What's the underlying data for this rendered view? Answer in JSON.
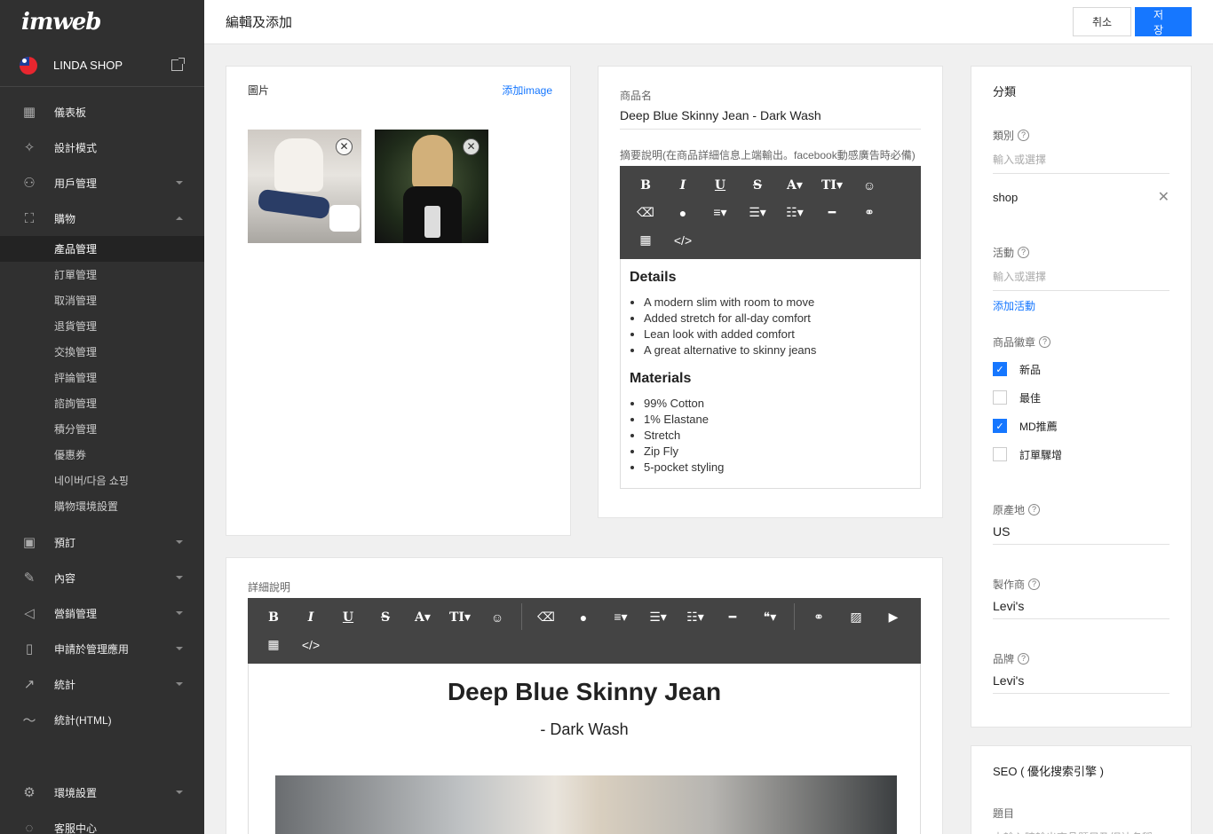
{
  "app": {
    "logo": "imweb",
    "shop_name": "LINDA SHOP"
  },
  "sidebar": {
    "items": [
      {
        "icon": "dashboard-icon",
        "label": "儀表板"
      },
      {
        "icon": "magic-wand-icon",
        "label": "設計模式"
      },
      {
        "icon": "user-icon",
        "label": "用戶管理"
      },
      {
        "icon": "shopping-bag-icon",
        "label": "購物"
      }
    ],
    "shopping_sub": [
      "產品管理",
      "訂單管理",
      "取消管理",
      "退貨管理",
      "交換管理",
      "評論管理",
      "諮詢管理",
      "積分管理",
      "優惠券",
      "네이버/다음 쇼핑",
      "購物環境設置"
    ],
    "items2": [
      {
        "icon": "calendar-icon",
        "label": "預訂"
      },
      {
        "icon": "edit-icon",
        "label": "內容"
      },
      {
        "icon": "megaphone-icon",
        "label": "營銷管理"
      },
      {
        "icon": "mobile-icon",
        "label": "申請於管理應用"
      },
      {
        "icon": "chart-icon",
        "label": "統計"
      },
      {
        "icon": "trend-icon",
        "label": "統計(HTML)"
      }
    ],
    "settings": "環境設置",
    "support": "客服中心"
  },
  "header": {
    "title": "編輯及添加",
    "cancel": "취소",
    "save": "저장"
  },
  "images": {
    "label": "圖片",
    "add": "添加image"
  },
  "product": {
    "name_label": "商品名",
    "name_value": "Deep Blue Skinny Jean - Dark Wash",
    "summary_label": "摘要說明(在商品詳細信息上端輸出。facebook動感廣告時必備)",
    "summary": {
      "h1": "Details",
      "list1": [
        "A modern slim with room to move",
        "Added stretch for all-day comfort",
        "Lean look with added comfort",
        "A great alternative to skinny jeans"
      ],
      "h2": "Materials",
      "list2": [
        "99% Cotton",
        "1% Elastane",
        "Stretch",
        "Zip Fly",
        "5-pocket styling"
      ]
    }
  },
  "detail": {
    "label": "詳細說明",
    "title": "Deep Blue Skinny Jean",
    "subtitle": "- Dark Wash"
  },
  "category": {
    "title": "分類",
    "class_label": "類別",
    "class_placeholder": "輸入或選擇",
    "tag": "shop",
    "event_label": "活動",
    "event_placeholder": "輸入或選擇",
    "add_event": "添加活動",
    "badge_label": "商品徽章",
    "badges": [
      {
        "label": "新品",
        "checked": true
      },
      {
        "label": "最佳",
        "checked": false
      },
      {
        "label": "MD推薦",
        "checked": true
      },
      {
        "label": "訂單驟增",
        "checked": false
      }
    ],
    "origin_label": "原產地",
    "origin": "US",
    "maker_label": "製作商",
    "maker": "Levi's",
    "brand_label": "品牌",
    "brand": "Levi's"
  },
  "seo": {
    "title": "SEO ( 優化搜索引擎 )",
    "title_label": "題目",
    "title_placeholder": "未輸入時輸出商品題目及網站名稱"
  },
  "colors": {
    "accent": "#1677ff",
    "sidebar": "#303030",
    "toolbar": "#444444"
  }
}
